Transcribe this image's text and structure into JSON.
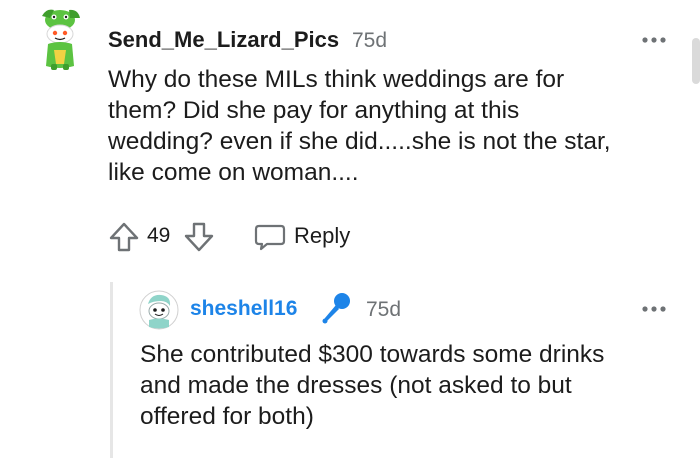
{
  "comment": {
    "username": "Send_Me_Lizard_Pics",
    "age": "75d",
    "body_lines": [
      "Why do these MILs think weddings are for",
      "them? Did she pay for anything at this",
      "wedding? even if she did.....she is not the star,",
      "like come on woman...."
    ],
    "score": "49",
    "reply_label": "Reply",
    "avatar_icon": "lizard-snoo-avatar-icon",
    "more_icon": "more-options-icon"
  },
  "reply": {
    "username": "sheshell16",
    "age": "75d",
    "badge_icon": "microphone-icon",
    "body_lines": [
      "She contributed $300 towards some drinks",
      "and made the dresses (not asked to but",
      "offered for both)"
    ],
    "avatar_icon": "snoo-avatar-icon",
    "more_icon": "more-options-icon"
  },
  "colors": {
    "username_reply": "#1d84e8",
    "meta_gray": "#6e7275",
    "text": "#1c1c1c",
    "avatar_green": "#4fbe3a"
  }
}
